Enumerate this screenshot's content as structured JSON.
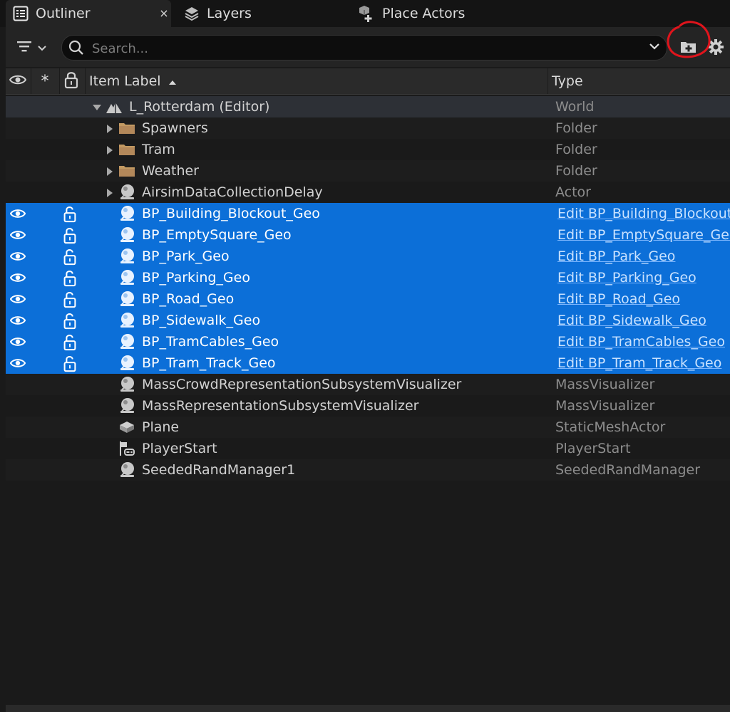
{
  "tabs": [
    {
      "label": "Outliner",
      "icon": "outliner-icon",
      "active": true
    },
    {
      "label": "Layers",
      "icon": "layers-icon",
      "active": false
    },
    {
      "label": "Place Actors",
      "icon": "place-actors-icon",
      "active": false
    }
  ],
  "tab_close_label": "×",
  "toolbar": {
    "search_placeholder": "Search...",
    "filter_icon": "filter-icon",
    "add_folder_icon": "add-folder-icon",
    "settings_icon": "gear-icon",
    "annotation": "red-hand-drawn-circle-around-add-folder"
  },
  "columns": {
    "visibility_icon": "eye-icon",
    "pinned_label": "*",
    "lock_icon": "lock-icon",
    "item_label": "Item Label",
    "sort_icon": "sort-ascending-icon",
    "type": "Type"
  },
  "colors": {
    "selection": "#0c6fd8",
    "annotation_red": "#e0141c",
    "folder": "#c39a62"
  },
  "rows": [
    {
      "label": "L_Rotterdam (Editor)",
      "type": "World",
      "icon": "world-icon",
      "level": 0,
      "expander": "down"
    },
    {
      "label": "Spawners",
      "type": "Folder",
      "icon": "folder-icon",
      "level": 1,
      "expander": "right"
    },
    {
      "label": "Tram",
      "type": "Folder",
      "icon": "folder-icon",
      "level": 1,
      "expander": "right"
    },
    {
      "label": "Weather",
      "type": "Folder",
      "icon": "folder-icon",
      "level": 1,
      "expander": "right"
    },
    {
      "label": "AirsimDataCollectionDelay",
      "type": "Actor",
      "icon": "actor-icon",
      "level": 1,
      "expander": "right"
    },
    {
      "label": "BP_Building_Blockout_Geo",
      "type": "Edit BP_Building_Blockout_Geo",
      "icon": "actor-icon",
      "level": 1,
      "selected": true
    },
    {
      "label": "BP_EmptySquare_Geo",
      "type": "Edit BP_EmptySquare_Geo",
      "icon": "actor-icon",
      "level": 1,
      "selected": true
    },
    {
      "label": "BP_Park_Geo",
      "type": "Edit BP_Park_Geo",
      "icon": "actor-icon",
      "level": 1,
      "selected": true
    },
    {
      "label": "BP_Parking_Geo",
      "type": "Edit BP_Parking_Geo",
      "icon": "actor-icon",
      "level": 1,
      "selected": true
    },
    {
      "label": "BP_Road_Geo",
      "type": "Edit BP_Road_Geo",
      "icon": "actor-icon",
      "level": 1,
      "selected": true
    },
    {
      "label": "BP_Sidewalk_Geo",
      "type": "Edit BP_Sidewalk_Geo",
      "icon": "actor-icon",
      "level": 1,
      "selected": true
    },
    {
      "label": "BP_TramCables_Geo",
      "type": "Edit BP_TramCables_Geo",
      "icon": "actor-icon",
      "level": 1,
      "selected": true
    },
    {
      "label": "BP_Tram_Track_Geo",
      "type": "Edit BP_Tram_Track_Geo",
      "icon": "actor-icon",
      "level": 1,
      "selected": true
    },
    {
      "label": "MassCrowdRepresentationSubsystemVisualizer",
      "type": "MassVisualizer",
      "icon": "actor-icon",
      "level": 1
    },
    {
      "label": "MassRepresentationSubsystemVisualizer",
      "type": "MassVisualizer",
      "icon": "actor-icon",
      "level": 1
    },
    {
      "label": "Plane",
      "type": "StaticMeshActor",
      "icon": "static-mesh-icon",
      "level": 1
    },
    {
      "label": "PlayerStart",
      "type": "PlayerStart",
      "icon": "player-start-icon",
      "level": 1
    },
    {
      "label": "SeededRandManager1",
      "type": "SeededRandManager",
      "icon": "actor-icon",
      "level": 1
    }
  ]
}
